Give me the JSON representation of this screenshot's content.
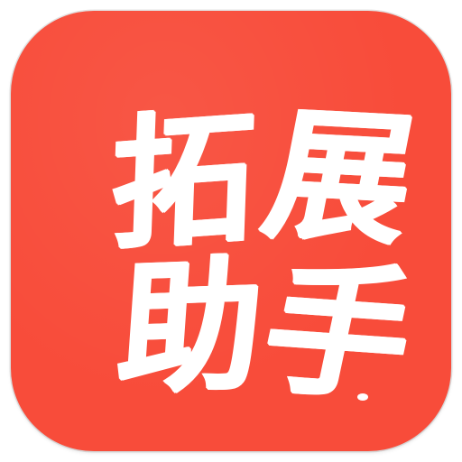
{
  "app_icon": {
    "background_color": "#F84C3A",
    "text_color": "#FFFFFF",
    "characters": [
      "拓",
      "展",
      "助",
      "手"
    ]
  }
}
